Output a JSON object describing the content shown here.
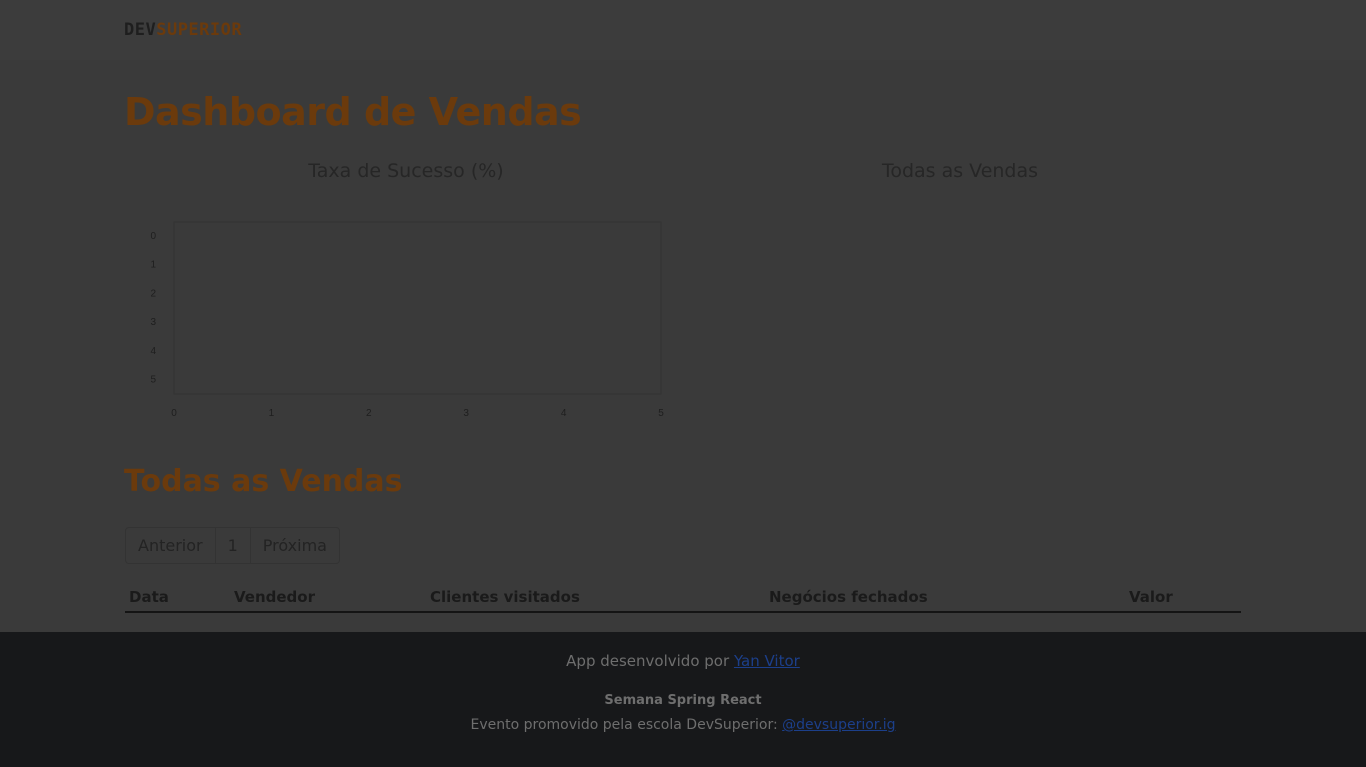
{
  "navbar": {
    "logo_part1": "DEV",
    "logo_part2": "SUPERIOR"
  },
  "main": {
    "title": "Dashboard de Vendas",
    "charts": {
      "left_title": "Taxa de Sucesso (%)",
      "right_title": "Todas as Vendas"
    },
    "section_title": "Todas as Vendas",
    "pagination": {
      "prev": "Anterior",
      "current": "1",
      "next": "Próxima"
    },
    "table": {
      "columns": [
        "Data",
        "Vendedor",
        "Clientes visitados",
        "Negócios fechados",
        "Valor"
      ]
    }
  },
  "footer": {
    "credit_prefix": "App desenvolvido por",
    "credit_link": "Yan Vitor",
    "event_title": "Semana Spring React",
    "event_prefix": "Evento promovido pela escola DevSuperior:",
    "event_link": "@devsuperior.ig"
  },
  "colors": {
    "accent": "#6b3a0c",
    "background": "#3a3a3a",
    "footer_bg": "#17181a",
    "link": "#1c3f8a"
  },
  "chart_data": {
    "type": "bar",
    "title": "",
    "xlabel": "",
    "ylabel": "",
    "x_ticks": [
      "0",
      "1",
      "2",
      "3",
      "4",
      "5"
    ],
    "y_ticks": [
      "0",
      "1",
      "2",
      "3",
      "4",
      "5"
    ],
    "xlim": [
      0,
      5
    ],
    "ylim": [
      0,
      5
    ],
    "series": []
  }
}
